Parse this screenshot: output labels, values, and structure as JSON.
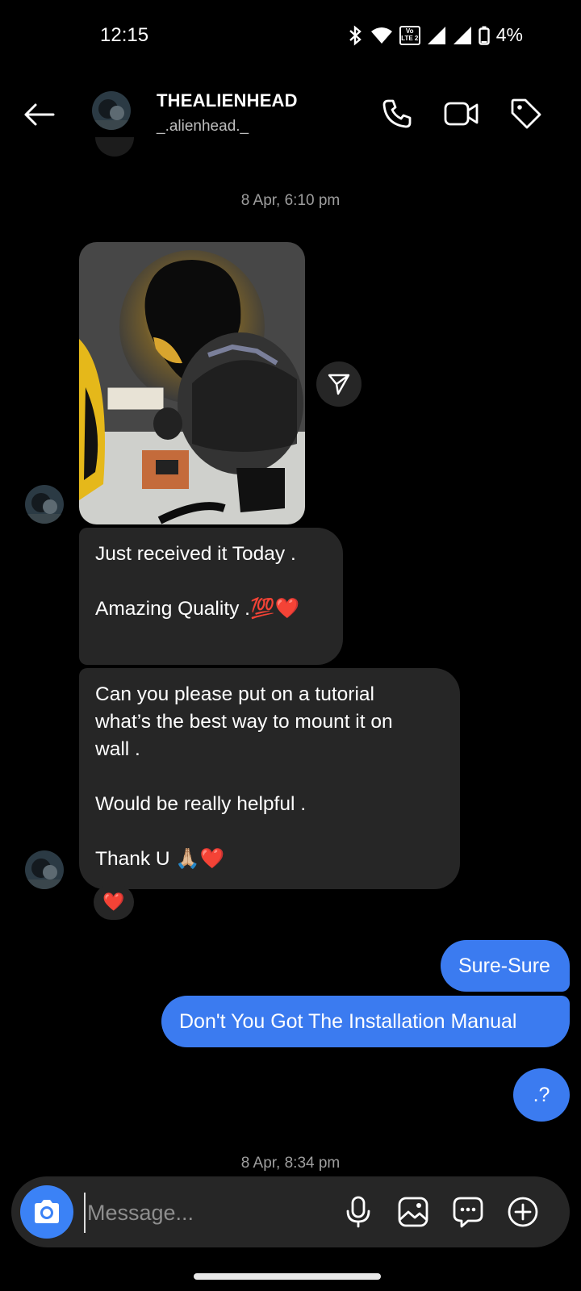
{
  "status_bar": {
    "time": "12:15",
    "network_badge_top": "Vo",
    "network_badge_bottom": "LTE 2",
    "battery": "4%"
  },
  "header": {
    "title": "THEALIENHEAD",
    "username": "_.alienhead._"
  },
  "thread": {
    "timestamp_1": "8 Apr, 6:10 pm",
    "timestamp_2": "8 Apr, 8:34 pm",
    "messages_in": [
      {
        "line1": "Just received it Today .",
        "line2": "Amazing Quality .💯❤️"
      },
      {
        "line1": "Can you please put on a tutorial",
        "line2": "what’s the best way to mount it on",
        "line3": "wall .",
        "line4": "Would be really helpful .",
        "line5": "Thank U 🙏🏼❤️"
      }
    ],
    "reaction": "❤️",
    "messages_out": [
      "Sure-Sure",
      "Don't You Got The Installation Manual",
      ".?"
    ]
  },
  "composer": {
    "placeholder": "Message..."
  },
  "colors": {
    "accent_blue": "#3b7bf0",
    "bubble_gray": "#262626",
    "background": "#000000"
  },
  "icons": [
    "back-arrow-icon",
    "phone-icon",
    "video-icon",
    "tag-icon",
    "send-icon",
    "camera-icon",
    "microphone-icon",
    "gallery-icon",
    "sticker-icon",
    "plus-icon"
  ]
}
